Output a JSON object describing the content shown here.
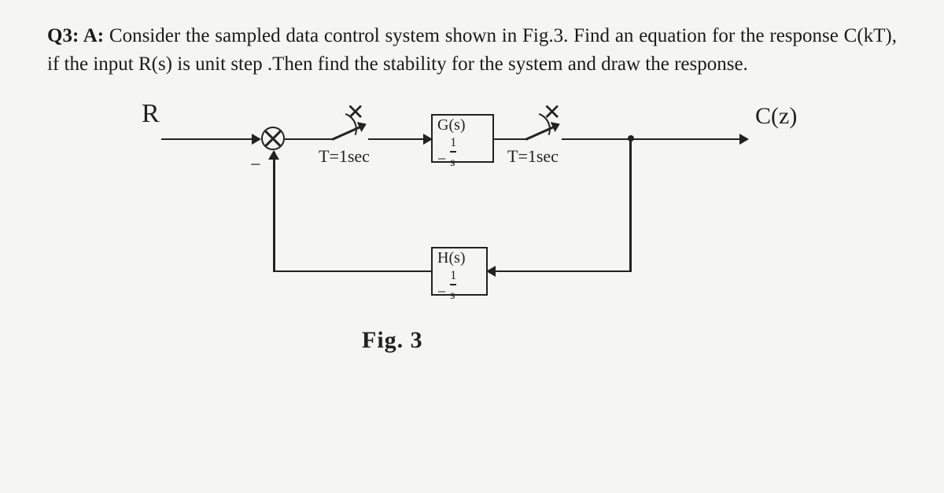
{
  "question": {
    "label": "Q3: A:",
    "text": "Consider the sampled data control system shown in Fig.3. Find an equation for the response C(kT), if the input R(s) is unit step .Then find the stability for the system and draw the response."
  },
  "diagram": {
    "input_label": "R",
    "output_label": "C(z)",
    "sum_minus": "−",
    "sampler1_label": "T=1sec",
    "sampler2_label": "T=1sec",
    "block_g": {
      "name": "G(s)",
      "expr": "= 1/s"
    },
    "block_h": {
      "name": "H(s)",
      "expr": "= 1/s"
    },
    "caption": "Fig. 3",
    "switch_x1": "✕",
    "switch_x2": "✕"
  }
}
